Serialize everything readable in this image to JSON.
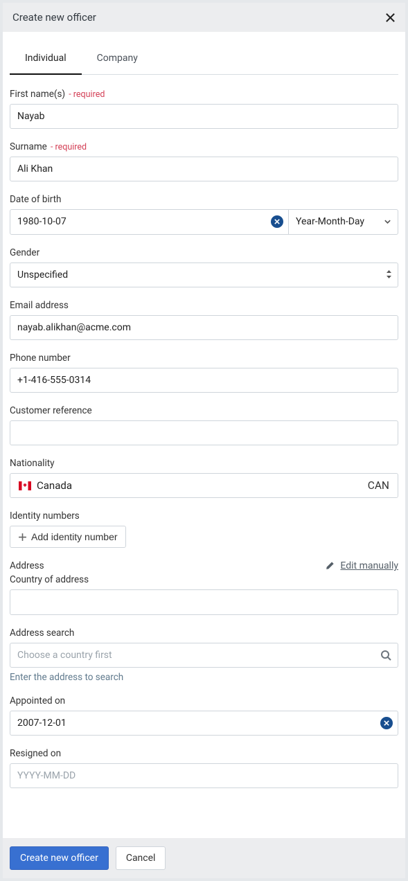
{
  "header": {
    "title": "Create new officer"
  },
  "tabs": {
    "individual": "Individual",
    "company": "Company"
  },
  "labels": {
    "first_name": "First name(s)",
    "surname": "Surname",
    "required": " - required",
    "dob": "Date of birth",
    "gender": "Gender",
    "email": "Email address",
    "phone": "Phone number",
    "customer_ref": "Customer reference",
    "nationality": "Nationality",
    "identity": "Identity numbers",
    "add_identity": "Add identity number",
    "address": "Address",
    "edit_manually": "Edit manually",
    "country_address": "Country of address",
    "address_search": "Address search",
    "address_search_placeholder": "Choose a country first",
    "address_help": "Enter the address to search",
    "appointed": "Appointed on",
    "resigned": "Resigned on",
    "resigned_placeholder": "YYYY-MM-DD"
  },
  "values": {
    "first_name": "Nayab",
    "surname": "Ali Khan",
    "dob": "1980-10-07",
    "dob_format": "Year-Month-Day",
    "gender": "Unspecified",
    "email": "nayab.alikhan@acme.com",
    "phone": "+1-416-555-0314",
    "customer_ref": "",
    "nationality_name": "Canada",
    "nationality_code": "CAN",
    "country_address": "",
    "address_search": "",
    "appointed": "2007-12-01",
    "resigned": ""
  },
  "footer": {
    "primary": "Create new officer",
    "secondary": "Cancel"
  }
}
